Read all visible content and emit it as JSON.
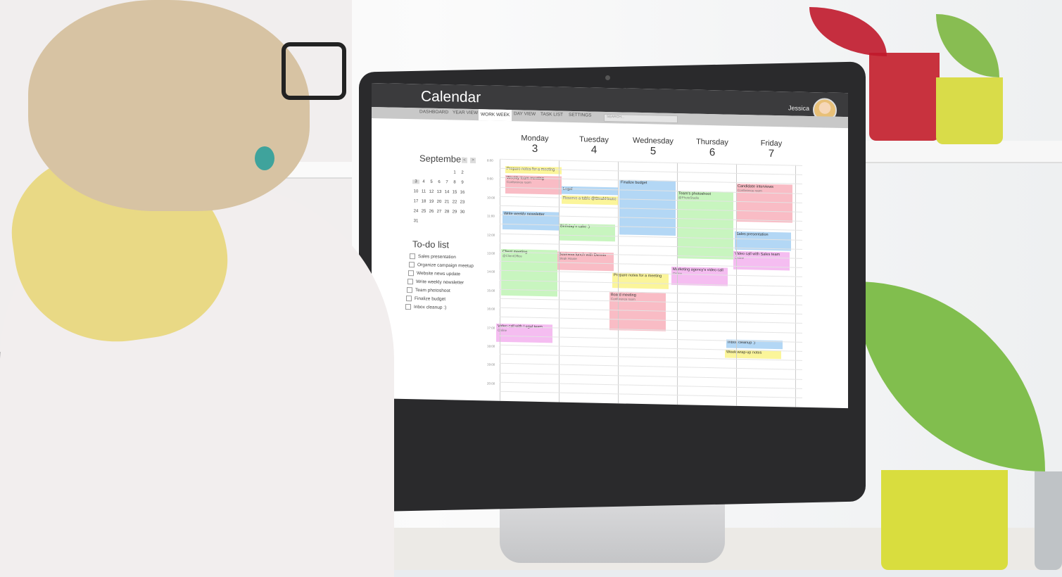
{
  "app": {
    "title": "Calendar",
    "user_name": "Jessica"
  },
  "nav": {
    "items": [
      "DASHBOARD",
      "YEAR VIEW",
      "WORK WEEK",
      "DAY VIEW",
      "TASK LIST",
      "SETTINGS"
    ],
    "active": "WORK WEEK",
    "search_placeholder": "SEARCH..."
  },
  "mini_calendar": {
    "month": "September",
    "prev": "<",
    "next": ">",
    "selected_day": "3",
    "weeks": [
      [
        "",
        "",
        "",
        "",
        "",
        "1",
        "2"
      ],
      [
        "3",
        "4",
        "5",
        "6",
        "7",
        "8",
        "9"
      ],
      [
        "10",
        "11",
        "12",
        "13",
        "14",
        "15",
        "16"
      ],
      [
        "17",
        "18",
        "19",
        "20",
        "21",
        "22",
        "23"
      ],
      [
        "24",
        "25",
        "26",
        "27",
        "28",
        "29",
        "30"
      ],
      [
        "31",
        "",
        "",
        "",
        "",
        "",
        ""
      ]
    ]
  },
  "todo": {
    "title": "To-do list",
    "items": [
      "Sales presentation",
      "Organize campaign meetup",
      "Website news update",
      "Write weekly newsletter",
      "Team photoshoot",
      "Finalize budget",
      "Inbox cleanup :)"
    ]
  },
  "days": [
    {
      "name": "Monday",
      "num": "3"
    },
    {
      "name": "Tuesday",
      "num": "4"
    },
    {
      "name": "Wednesday",
      "num": "5"
    },
    {
      "name": "Thursday",
      "num": "6"
    },
    {
      "name": "Friday",
      "num": "7"
    }
  ],
  "times": [
    "8:00",
    "9:00",
    "10:00",
    "11:00",
    "12:00",
    "13:00",
    "14:00",
    "15:00",
    "16:00",
    "17:00",
    "18:00",
    "19:00",
    "20:00"
  ],
  "events": {
    "mon_1": {
      "title": "Prepare notes for a meeting",
      "color": "#fbf59a"
    },
    "mon_2": {
      "title": "Weekly team meeting",
      "sub": "Conference room",
      "color": "#f9bcc5"
    },
    "mon_3": {
      "title": "Write weekly newsletter",
      "color": "#b3d7f5"
    },
    "mon_4": {
      "title": "Client meeting",
      "sub": "@ClientOffice",
      "color": "#c8f5bf"
    },
    "mon_5": {
      "title": "Video call with Legal team",
      "sub": "Online",
      "color": "#f5bdf1"
    },
    "tue_1": {
      "title": "Legal",
      "color": "#b3d7f5"
    },
    "tue_2": {
      "title": "Reserve a table @SteakHouse",
      "color": "#fbf59a"
    },
    "tue_3": {
      "title": "Birthday's cake :)",
      "color": "#c8f5bf"
    },
    "tue_4": {
      "title": "Business lunch with Dennis",
      "sub": "Steak House",
      "color": "#f9bcc5"
    },
    "wed_1": {
      "title": "Finalize budget",
      "color": "#b3d7f5"
    },
    "wed_2": {
      "title": "Prepare notes for a meeting",
      "color": "#fbf59a"
    },
    "wed_3": {
      "title": "Board meeting",
      "sub": "Conference room",
      "color": "#f9bcc5"
    },
    "thu_1": {
      "title": "Team's photoshoot",
      "sub": "@PhotoStudio",
      "color": "#c8f5bf"
    },
    "thu_2": {
      "title": "Marketing agency's video call",
      "sub": "Online",
      "color": "#f5bdf1"
    },
    "fri_1": {
      "title": "Candidate interviews",
      "sub": "Conference room",
      "color": "#f9bcc5"
    },
    "fri_2": {
      "title": "Sales presentation",
      "color": "#b3d7f5"
    },
    "fri_3": {
      "title": "Video call with Sales team",
      "sub": "Online",
      "color": "#f5bdf1"
    },
    "fri_4": {
      "title": "Inbox cleanup :)",
      "color": "#b3d7f5"
    },
    "fri_5": {
      "title": "Week wrap-up notes",
      "color": "#fbf59a"
    }
  }
}
